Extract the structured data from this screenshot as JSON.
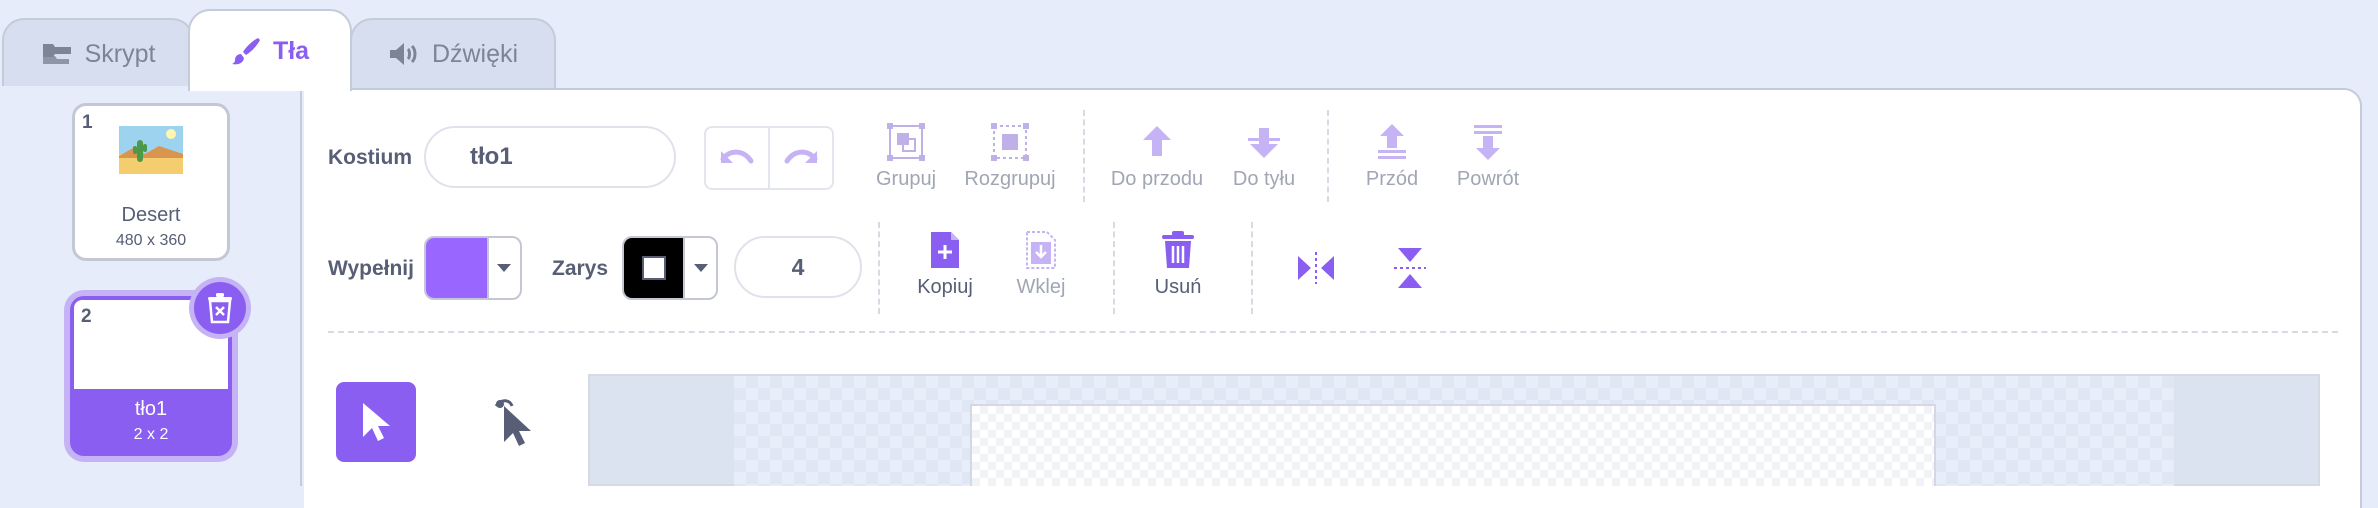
{
  "tabs": [
    {
      "label": "Skrypt",
      "icon": "code-blocks-icon"
    },
    {
      "label": "Tła",
      "icon": "brush-icon",
      "active": true
    },
    {
      "label": "Dźwięki",
      "icon": "speaker-icon"
    }
  ],
  "costumes": [
    {
      "number": "1",
      "name": "Desert",
      "size": "480 x 360"
    },
    {
      "number": "2",
      "name": "tło1",
      "size": "2 x 2",
      "selected": true
    }
  ],
  "toolbar": {
    "costume_label": "Kostium",
    "costume_name": "tło1",
    "group": "Grupuj",
    "ungroup": "Rozgrupuj",
    "forward": "Do przodu",
    "backward": "Do tyłu",
    "front": "Przód",
    "back": "Powrót",
    "fill_label": "Wypełnij",
    "outline_label": "Zarys",
    "outline_width": "4",
    "copy": "Kopiuj",
    "paste": "Wklej",
    "delete": "Usuń"
  },
  "colors": {
    "accent": "#8a5ef0",
    "fill": "#9966ff",
    "outline": "#000000",
    "disabled": "#a0a6b4",
    "text": "#575e75"
  }
}
